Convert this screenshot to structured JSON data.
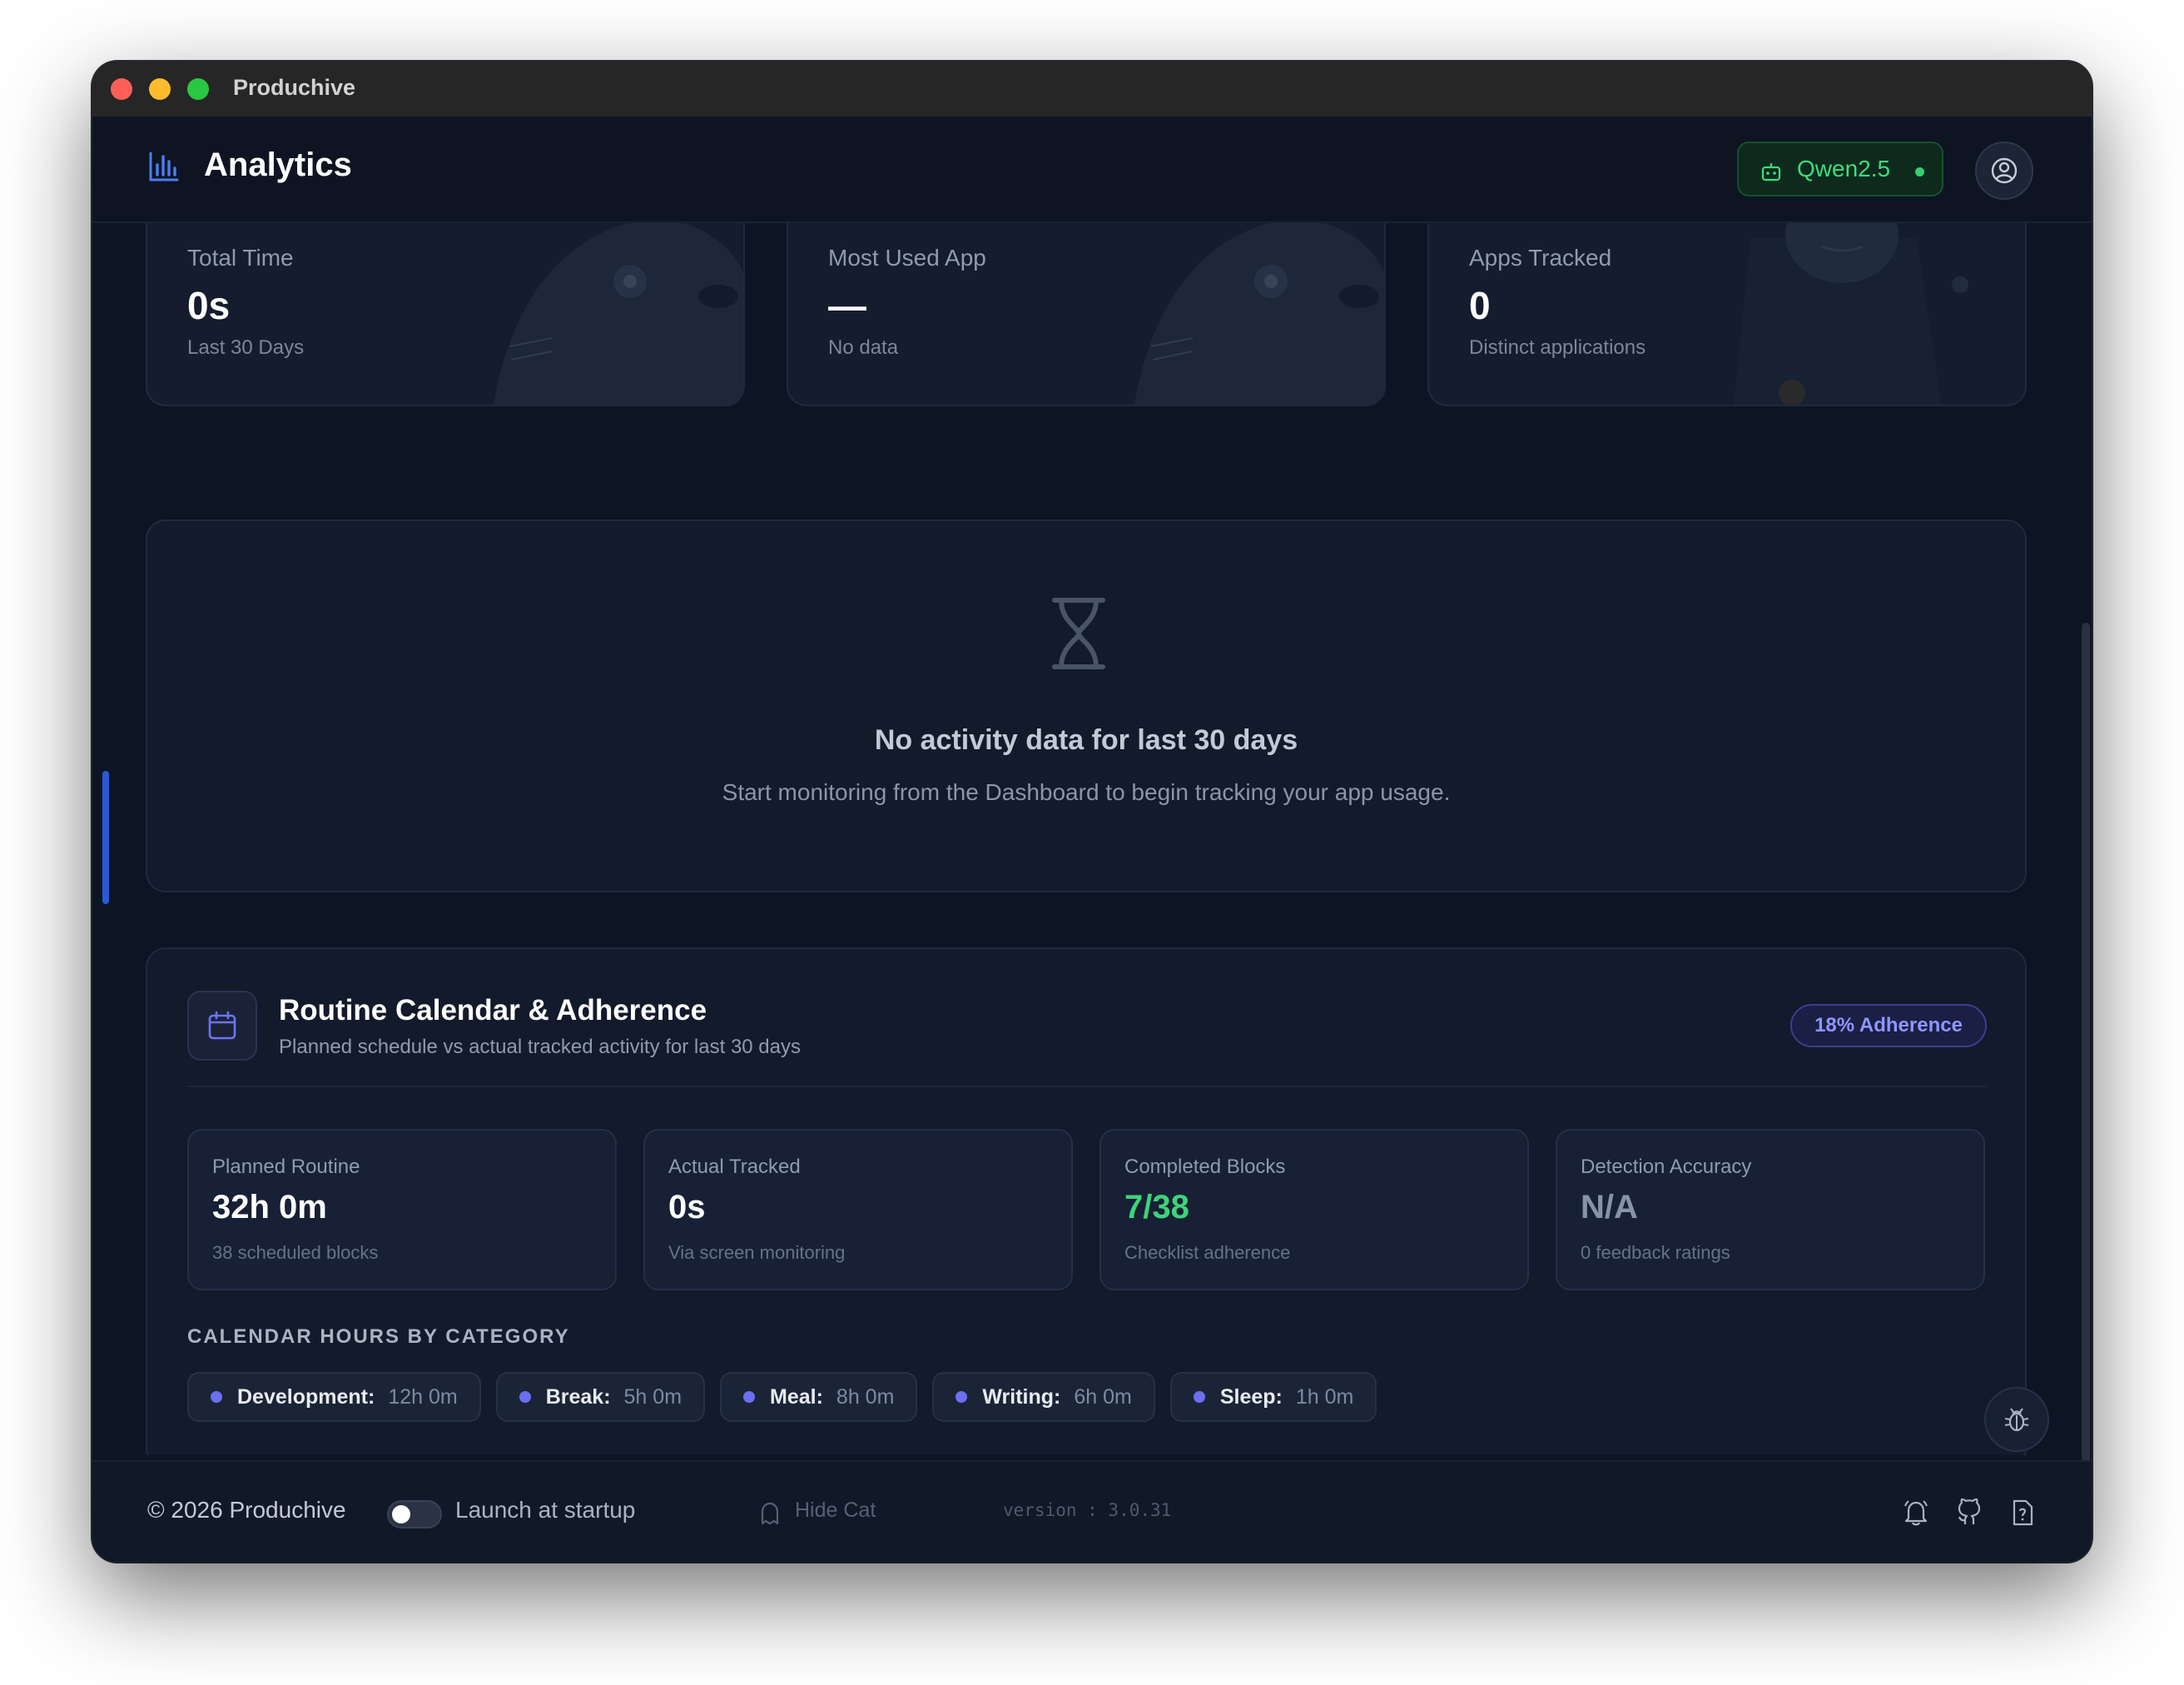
{
  "window": {
    "title": "Produchive"
  },
  "header": {
    "title": "Analytics",
    "model_badge": "Qwen2.5",
    "colors": {
      "accent": "#4d7cf4",
      "model_green": "#3edc7b"
    }
  },
  "stats": [
    {
      "label": "Total Time",
      "value": "0s",
      "sub": "Last 30 Days"
    },
    {
      "label": "Most Used App",
      "value": "—",
      "sub": "No data"
    },
    {
      "label": "Apps Tracked",
      "value": "0",
      "sub": "Distinct applications"
    }
  ],
  "empty_state": {
    "icon": "hourglass-icon",
    "title": "No activity data for last 30 days",
    "subtitle": "Start monitoring from the Dashboard to begin tracking your app usage."
  },
  "routine": {
    "title": "Routine Calendar & Adherence",
    "subtitle": "Planned schedule vs actual tracked activity for last 30 days",
    "adherence": "18% Adherence",
    "metrics": [
      {
        "label": "Planned Routine",
        "value": "32h 0m",
        "sub": "38 scheduled blocks"
      },
      {
        "label": "Actual Tracked",
        "value": "0s",
        "sub": "Via screen monitoring"
      },
      {
        "label": "Completed Blocks",
        "value": "7/38",
        "sub": "Checklist adherence"
      },
      {
        "label": "Detection Accuracy",
        "value": "N/A",
        "sub": "0 feedback ratings"
      }
    ],
    "category_heading": "CALENDAR HOURS BY CATEGORY",
    "categories": [
      {
        "name": "Development:",
        "value": "12h 0m"
      },
      {
        "name": "Break:",
        "value": "5h 0m"
      },
      {
        "name": "Meal:",
        "value": "8h 0m"
      },
      {
        "name": "Writing:",
        "value": "6h 0m"
      },
      {
        "name": "Sleep:",
        "value": "1h 0m"
      }
    ],
    "colors": {
      "completed_green": "#3fd37a",
      "category_dot": "#6b6ff0"
    }
  },
  "footer": {
    "copyright": "© 2026 Produchive",
    "launch_label": "Launch at startup",
    "launch_enabled": false,
    "hide_cat": "Hide Cat",
    "version": "version : 3.0.31"
  }
}
